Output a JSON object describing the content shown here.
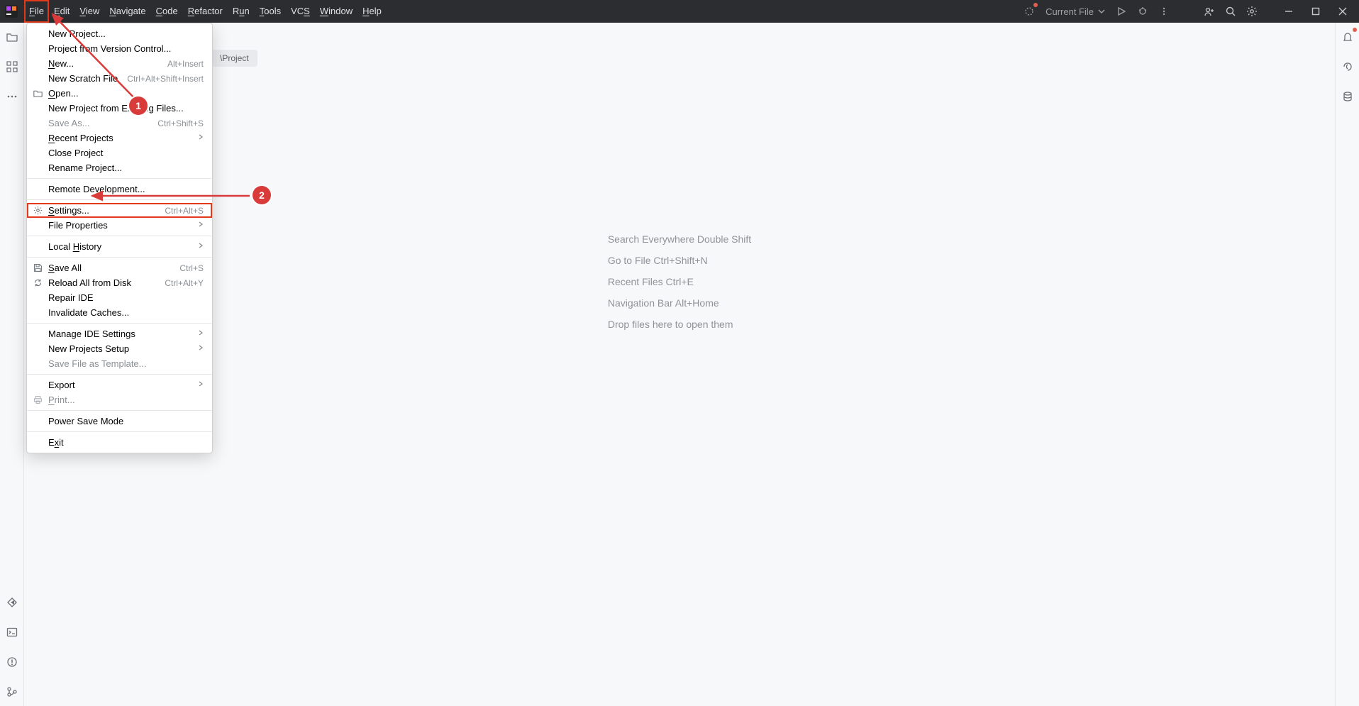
{
  "menubar": {
    "items": [
      {
        "label": "File",
        "u": "F"
      },
      {
        "label": "Edit",
        "u": "E"
      },
      {
        "label": "View",
        "u": "V"
      },
      {
        "label": "Navigate",
        "u": "N"
      },
      {
        "label": "Code",
        "u": "C"
      },
      {
        "label": "Refactor",
        "u": "R"
      },
      {
        "label": "Run",
        "u": "u"
      },
      {
        "label": "Tools",
        "u": "T"
      },
      {
        "label": "VCS",
        "u": "S"
      },
      {
        "label": "Window",
        "u": "W"
      },
      {
        "label": "Help",
        "u": "H"
      }
    ],
    "run_config": "Current File"
  },
  "breadcrumb": {
    "label": "\\Project"
  },
  "welcome": {
    "lines": [
      "Search Everywhere Double Shift",
      "Go to File Ctrl+Shift+N",
      "Recent Files Ctrl+E",
      "Navigation Bar Alt+Home",
      "Drop files here to open them"
    ]
  },
  "file_menu": {
    "items": [
      {
        "label": "New Project...",
        "u": null
      },
      {
        "label": "Project from Version Control...",
        "u": null
      },
      {
        "label": "New...",
        "u": "N",
        "shortcut": "Alt+Insert"
      },
      {
        "label": "New Scratch File",
        "shortcut": "Ctrl+Alt+Shift+Insert"
      },
      {
        "label": "Open...",
        "u": "O",
        "icon": "folder"
      },
      {
        "label": "New Project from Existing Files..."
      },
      {
        "label": "Save As...",
        "disabled": true,
        "shortcut": "Ctrl+Shift+S"
      },
      {
        "label": "Recent Projects",
        "u": "R",
        "submenu": true
      },
      {
        "label": "Close Project"
      },
      {
        "label": "Rename Project..."
      },
      {
        "sep": true
      },
      {
        "label": "Remote Development..."
      },
      {
        "sep": true
      },
      {
        "label": "Settings...",
        "u": "S",
        "icon": "gear",
        "shortcut": "Ctrl+Alt+S",
        "highlight": true
      },
      {
        "label": "File Properties",
        "submenu": true
      },
      {
        "sep": true
      },
      {
        "label": "Local History",
        "u": "H",
        "submenu": true
      },
      {
        "sep": true
      },
      {
        "label": "Save All",
        "u": "S",
        "icon": "save",
        "shortcut": "Ctrl+S"
      },
      {
        "label": "Reload All from Disk",
        "icon": "reload",
        "shortcut": "Ctrl+Alt+Y"
      },
      {
        "label": "Repair IDE"
      },
      {
        "label": "Invalidate Caches..."
      },
      {
        "sep": true
      },
      {
        "label": "Manage IDE Settings",
        "submenu": true
      },
      {
        "label": "New Projects Setup",
        "submenu": true
      },
      {
        "label": "Save File as Template...",
        "disabled": true
      },
      {
        "sep": true
      },
      {
        "label": "Export",
        "submenu": true
      },
      {
        "label": "Print...",
        "u": "P",
        "icon": "print",
        "disabled": true
      },
      {
        "sep": true
      },
      {
        "label": "Power Save Mode"
      },
      {
        "sep": true
      },
      {
        "label": "Exit",
        "u": "x"
      }
    ]
  },
  "annotations": {
    "badge1": "1",
    "badge2": "2"
  }
}
